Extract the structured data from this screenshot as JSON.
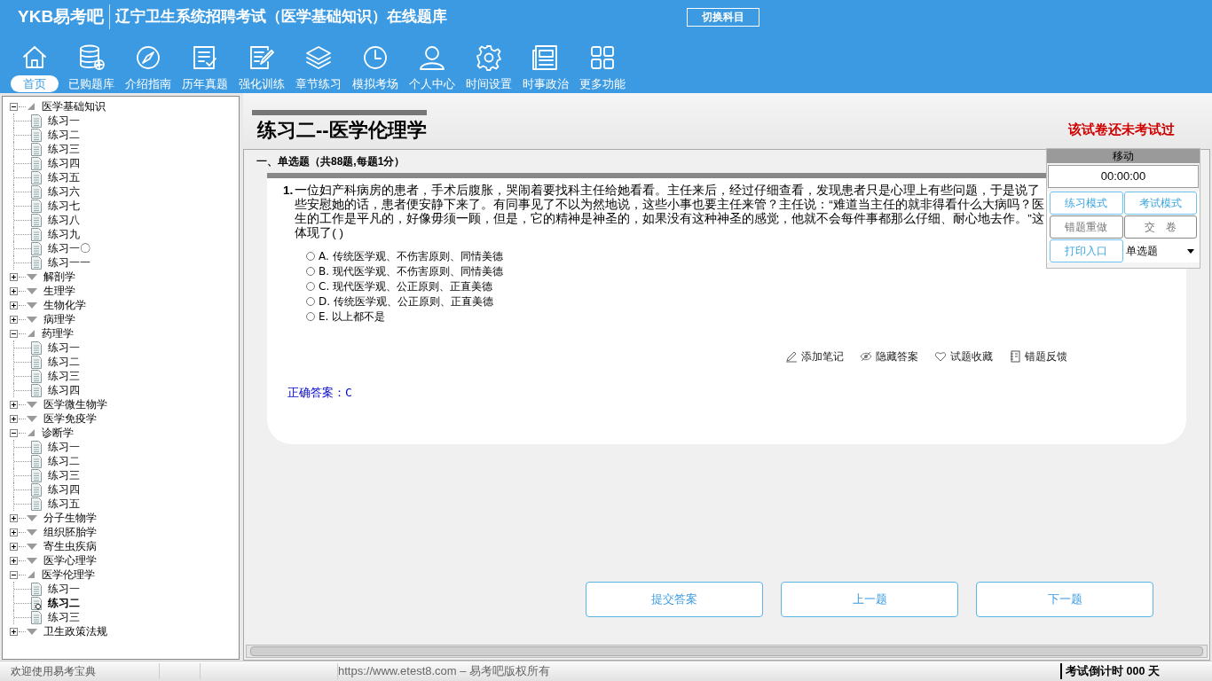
{
  "header": {
    "logo": "YKB易考吧",
    "title": "辽宁卫生系统招聘考试（医学基础知识）在线题库",
    "switch_button": "切换科目"
  },
  "nav": [
    {
      "label": "首页",
      "selected": true
    },
    {
      "label": "已购题库",
      "selected": false
    },
    {
      "label": "介绍指南",
      "selected": false
    },
    {
      "label": "历年真题",
      "selected": false
    },
    {
      "label": "强化训练",
      "selected": false
    },
    {
      "label": "章节练习",
      "selected": false
    },
    {
      "label": "模拟考场",
      "selected": false
    },
    {
      "label": "个人中心",
      "selected": false
    },
    {
      "label": "时间设置",
      "selected": false
    },
    {
      "label": "时事政治",
      "selected": false
    },
    {
      "label": "更多功能",
      "selected": false
    }
  ],
  "tree": [
    {
      "label": "医学基础知识",
      "expanded": true,
      "children": [
        {
          "label": "练习一",
          "selected": false
        },
        {
          "label": "练习二",
          "selected": false
        },
        {
          "label": "练习三",
          "selected": false
        },
        {
          "label": "练习四",
          "selected": false
        },
        {
          "label": "练习五",
          "selected": false
        },
        {
          "label": "练习六",
          "selected": false
        },
        {
          "label": "练习七",
          "selected": false
        },
        {
          "label": "练习八",
          "selected": false
        },
        {
          "label": "练习九",
          "selected": false
        },
        {
          "label": "练习一〇",
          "selected": false
        },
        {
          "label": "练习一一",
          "selected": false
        }
      ]
    },
    {
      "label": "解剖学",
      "expanded": false
    },
    {
      "label": "生理学",
      "expanded": false
    },
    {
      "label": "生物化学",
      "expanded": false
    },
    {
      "label": "病理学",
      "expanded": false
    },
    {
      "label": "药理学",
      "expanded": true,
      "children": [
        {
          "label": "练习一",
          "selected": false
        },
        {
          "label": "练习二",
          "selected": false
        },
        {
          "label": "练习三",
          "selected": false
        },
        {
          "label": "练习四",
          "selected": false
        }
      ]
    },
    {
      "label": "医学微生物学",
      "expanded": false
    },
    {
      "label": "医学免疫学",
      "expanded": false
    },
    {
      "label": "诊断学",
      "expanded": true,
      "children": [
        {
          "label": "练习一",
          "selected": false
        },
        {
          "label": "练习二",
          "selected": false
        },
        {
          "label": "练习三",
          "selected": false
        },
        {
          "label": "练习四",
          "selected": false
        },
        {
          "label": "练习五",
          "selected": false
        }
      ]
    },
    {
      "label": "分子生物学",
      "expanded": false
    },
    {
      "label": "组织胚胎学",
      "expanded": false
    },
    {
      "label": "寄生虫疾病",
      "expanded": false
    },
    {
      "label": "医学心理学",
      "expanded": false
    },
    {
      "label": "医学伦理学",
      "expanded": true,
      "children": [
        {
          "label": "练习一",
          "selected": false
        },
        {
          "label": "练习二",
          "selected": true
        },
        {
          "label": "练习三",
          "selected": false
        }
      ]
    },
    {
      "label": "卫生政策法规",
      "expanded": false
    }
  ],
  "paper": {
    "title": "练习二--医学伦理学",
    "status": "该试卷还未考试过",
    "section": "一、单选题（共88题,每题1分）"
  },
  "question": {
    "number": "1.",
    "text": "一位妇产科病房的患者，手术后腹胀，哭闹着要找科主任给她看看。主任来后，经过仔细查看，发现患者只是心理上有些问题，于是说了些安慰她的话，患者便安静下来了。有同事见了不以为然地说，这些小事也要主任来管？主任说：“难道当主任的就非得看什么大病吗？医生的工作是平凡的，好像毋须一顾，但是，它的精神是神圣的，如果没有这种神圣的感觉，他就不会每件事都那么仔细、耐心地去作。”这体现了( )",
    "options": [
      {
        "label": "A. 传统医学观、不伤害原则、同情美德",
        "selected": false
      },
      {
        "label": "B. 现代医学观、不伤害原则、同情美德",
        "selected": false
      },
      {
        "label": "C. 现代医学观、公正原则、正直美德",
        "selected": false
      },
      {
        "label": "D. 传统医学观、公正原则、正直美德",
        "selected": false
      },
      {
        "label": "E. 以上都不是",
        "selected": false
      }
    ],
    "actions": [
      "添加笔记",
      "隐藏答案",
      "试题收藏",
      "错题反馈"
    ],
    "answer": "正确答案：C"
  },
  "bottom_buttons": [
    "提交答案",
    "上一题",
    "下一题"
  ],
  "panel": {
    "title": "移动",
    "timer": "00:00:00",
    "buttons": [
      {
        "label": "练习模式",
        "disabled": false
      },
      {
        "label": "考试模式",
        "disabled": false
      },
      {
        "label": "错题重做",
        "disabled": true
      },
      {
        "label": "交　卷",
        "disabled": true
      },
      {
        "label": "打印入口",
        "disabled": false
      }
    ],
    "dropdown": "单选题"
  },
  "status_bar": {
    "welcome": "欢迎使用易考宝典",
    "copyright": "https://www.etest8.com – 易考吧版权所有",
    "countdown": "考试倒计时 000 天"
  }
}
